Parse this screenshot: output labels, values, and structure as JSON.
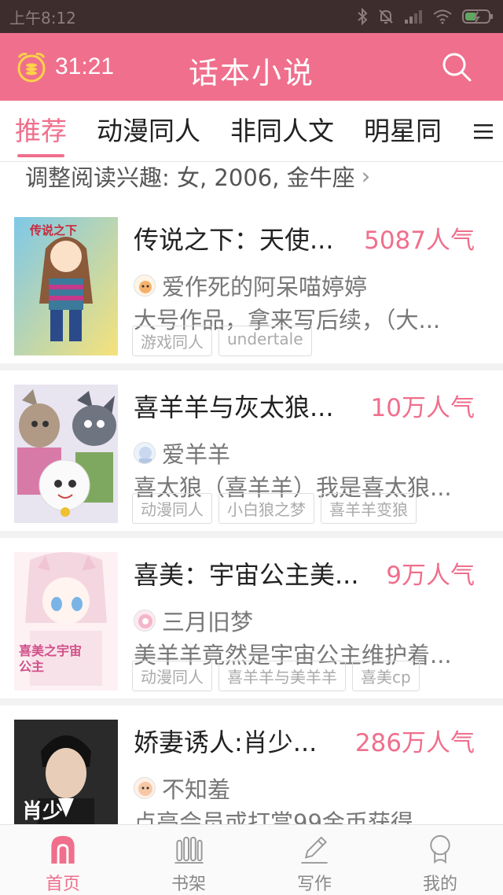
{
  "status_bar": {
    "time": "上午8:12"
  },
  "header": {
    "timer": "31:21",
    "title": "话本小说"
  },
  "tabs": [
    {
      "label": "推荐",
      "active": true
    },
    {
      "label": "动漫同人",
      "active": false
    },
    {
      "label": "非同人文",
      "active": false
    },
    {
      "label": "明星同",
      "active": false
    }
  ],
  "interest": {
    "text": "调整阅读兴趣: 女, 2006, 金牛座",
    "chevron": "›"
  },
  "books": [
    {
      "title": "传说之下：天使...",
      "popularity": "5087人气",
      "author": "爱作死的阿呆喵婷婷",
      "description": "大号作品，拿来写后续，（大...",
      "tags": [
        "游戏同人",
        "undertale"
      ],
      "cover_text": "传说之下"
    },
    {
      "title": "喜羊羊与灰太狼...",
      "popularity": "10万人气",
      "author": "爱羊羊",
      "description": "喜太狼（喜羊羊）我是喜太狼...",
      "tags": [
        "动漫同人",
        "小白狼之梦",
        "喜羊羊变狼"
      ],
      "cover_text": ""
    },
    {
      "title": "喜美：宇宙公主美...",
      "popularity": "9万人气",
      "author": "三月旧梦",
      "description": "美羊羊竟然是宇宙公主维护着...",
      "tags": [
        "动漫同人",
        "喜羊羊与美羊羊",
        "喜美cp"
      ],
      "cover_text": "喜美之宇宙公主"
    },
    {
      "title": "娇妻诱人:肖少...",
      "popularity": "286万人气",
      "author": "不知羞",
      "description": "点亮会员或打赏99金币获得",
      "tags": [],
      "cover_text": "肖少"
    }
  ],
  "bottom_nav": [
    {
      "label": "首页",
      "icon": "home-icon",
      "active": true
    },
    {
      "label": "书架",
      "icon": "bookshelf-icon",
      "active": false
    },
    {
      "label": "写作",
      "icon": "pencil-icon",
      "active": false
    },
    {
      "label": "我的",
      "icon": "profile-icon",
      "active": false
    }
  ],
  "colors": {
    "accent": "#ef6f8c",
    "status_bar": "#3d2d2d"
  }
}
